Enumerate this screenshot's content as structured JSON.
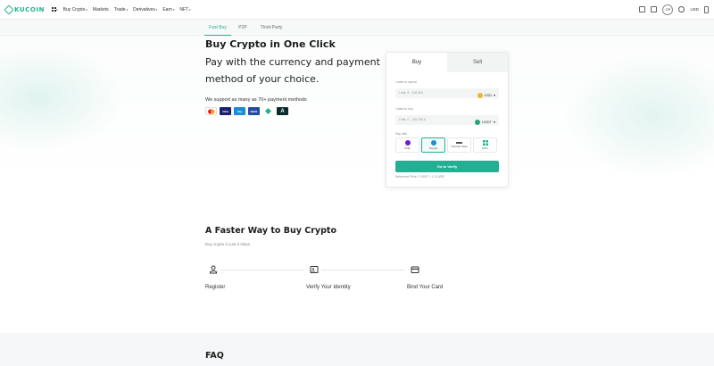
{
  "topbar": {
    "logo_text": "KUCOIN",
    "nav": [
      {
        "label": "Buy Crypto",
        "has_caret": true
      },
      {
        "label": "Markets",
        "has_caret": false
      },
      {
        "label": "Trade",
        "has_caret": true
      },
      {
        "label": "Derivatives",
        "has_caret": true
      },
      {
        "label": "Earn",
        "has_caret": true
      },
      {
        "label": "NFT",
        "has_caret": true
      }
    ],
    "profile_initials": "OP",
    "currency": "USD"
  },
  "subnav": {
    "tabs": [
      {
        "label": "Fast Buy",
        "active": true
      },
      {
        "label": "P2P",
        "active": false
      },
      {
        "label": "Third-Party",
        "active": false
      }
    ]
  },
  "hero": {
    "title": "Buy Crypto in One Click",
    "subtitle": "Pay with the currency and payment method of your choice.",
    "support_text": "We support as many as 70+ payment methods",
    "payment_logos": [
      "mastercard-icon",
      "visa-icon",
      "paypal-icon",
      "sepa-icon",
      "binance-connect-icon",
      "a-icon"
    ]
  },
  "buy_card": {
    "tabs": {
      "buy": "Buy",
      "sell": "Sell"
    },
    "spend_label": "I want to spend",
    "spend_placeholder": "Limit: 8 - 100,000",
    "spend_currency": "USD",
    "buy_label": "I want to buy",
    "buy_placeholder": "Limit: 0 - 135,780.5",
    "buy_currency": "USDT",
    "pay_with_label": "Pay with",
    "pay_options": [
      {
        "label": "Zelle",
        "selected": false,
        "color": "#6d1ed4"
      },
      {
        "label": "Paypal",
        "selected": true,
        "color": "#1a8cd8"
      },
      {
        "label": "Transfer Wise",
        "selected": false,
        "color": "#555555"
      },
      {
        "label": "More",
        "selected": false,
        "color": "#23af91"
      }
    ],
    "cta_label": "Go to Verify",
    "reference_price": "Reference Price: 1 USDT = 1.11 USD"
  },
  "steps_section": {
    "title": "A Faster Way to Buy Crypto",
    "subtitle": "Buy crypto in just 3 steps",
    "steps": [
      {
        "label": "Register",
        "icon": "user-icon"
      },
      {
        "label": "Verify Your Identity",
        "icon": "id-card-icon"
      },
      {
        "label": "Bind Your Card",
        "icon": "card-icon"
      }
    ]
  },
  "faq": {
    "title": "FAQ"
  },
  "colors": {
    "accent": "#23af91",
    "text": "#1d1d1d",
    "muted": "#888888"
  }
}
